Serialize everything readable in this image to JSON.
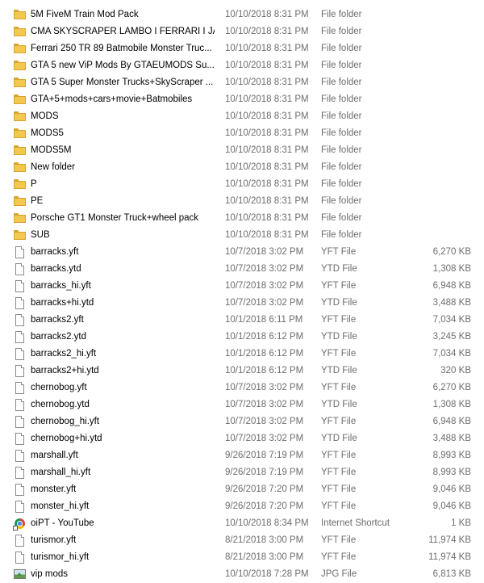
{
  "files": [
    {
      "name": "5M FiveM Train Mod Pack",
      "date": "10/10/2018 8:31 PM",
      "type": "File folder",
      "size": "",
      "icon": "folder-icon"
    },
    {
      "name": "CMA SKYSCRAPER LAMBO I FERRARI I JA...",
      "date": "10/10/2018 8:31 PM",
      "type": "File folder",
      "size": "",
      "icon": "folder-icon"
    },
    {
      "name": "Ferrari 250 TR 89 Batmobile Monster Truc...",
      "date": "10/10/2018 8:31 PM",
      "type": "File folder",
      "size": "",
      "icon": "folder-icon"
    },
    {
      "name": "GTA 5 new ViP Mods By GTAEUMODS Su...",
      "date": "10/10/2018 8:31 PM",
      "type": "File folder",
      "size": "",
      "icon": "folder-icon"
    },
    {
      "name": "GTA 5 Super Monster Trucks+SkyScraper ...",
      "date": "10/10/2018 8:31 PM",
      "type": "File folder",
      "size": "",
      "icon": "folder-icon"
    },
    {
      "name": "GTA+5+mods+cars+movie+Batmobiles",
      "date": "10/10/2018 8:31 PM",
      "type": "File folder",
      "size": "",
      "icon": "folder-icon"
    },
    {
      "name": "MODS",
      "date": "10/10/2018 8:31 PM",
      "type": "File folder",
      "size": "",
      "icon": "folder-icon"
    },
    {
      "name": "MODS5",
      "date": "10/10/2018 8:31 PM",
      "type": "File folder",
      "size": "",
      "icon": "folder-icon"
    },
    {
      "name": "MODS5M",
      "date": "10/10/2018 8:31 PM",
      "type": "File folder",
      "size": "",
      "icon": "folder-icon"
    },
    {
      "name": "New folder",
      "date": "10/10/2018 8:31 PM",
      "type": "File folder",
      "size": "",
      "icon": "folder-icon"
    },
    {
      "name": "P",
      "date": "10/10/2018 8:31 PM",
      "type": "File folder",
      "size": "",
      "icon": "folder-icon"
    },
    {
      "name": "PE",
      "date": "10/10/2018 8:31 PM",
      "type": "File folder",
      "size": "",
      "icon": "folder-icon"
    },
    {
      "name": "Porsche GT1 Monster Truck+wheel pack",
      "date": "10/10/2018 8:31 PM",
      "type": "File folder",
      "size": "",
      "icon": "folder-icon"
    },
    {
      "name": "SUB",
      "date": "10/10/2018 8:31 PM",
      "type": "File folder",
      "size": "",
      "icon": "folder-icon"
    },
    {
      "name": "barracks.yft",
      "date": "10/7/2018 3:02 PM",
      "type": "YFT File",
      "size": "6,270 KB",
      "icon": "file-icon"
    },
    {
      "name": "barracks.ytd",
      "date": "10/7/2018 3:02 PM",
      "type": "YTD File",
      "size": "1,308 KB",
      "icon": "file-icon"
    },
    {
      "name": "barracks_hi.yft",
      "date": "10/7/2018 3:02 PM",
      "type": "YFT File",
      "size": "6,948 KB",
      "icon": "file-icon"
    },
    {
      "name": "barracks+hi.ytd",
      "date": "10/7/2018 3:02 PM",
      "type": "YTD File",
      "size": "3,488 KB",
      "icon": "file-icon"
    },
    {
      "name": "barracks2.yft",
      "date": "10/1/2018 6:11 PM",
      "type": "YFT File",
      "size": "7,034 KB",
      "icon": "file-icon"
    },
    {
      "name": "barracks2.ytd",
      "date": "10/1/2018 6:12 PM",
      "type": "YTD File",
      "size": "3,245 KB",
      "icon": "file-icon"
    },
    {
      "name": "barracks2_hi.yft",
      "date": "10/1/2018 6:12 PM",
      "type": "YFT File",
      "size": "7,034 KB",
      "icon": "file-icon"
    },
    {
      "name": "barracks2+hi.ytd",
      "date": "10/1/2018 6:12 PM",
      "type": "YTD File",
      "size": "320 KB",
      "icon": "file-icon"
    },
    {
      "name": "chernobog.yft",
      "date": "10/7/2018 3:02 PM",
      "type": "YFT File",
      "size": "6,270 KB",
      "icon": "file-icon"
    },
    {
      "name": "chernobog.ytd",
      "date": "10/7/2018 3:02 PM",
      "type": "YTD File",
      "size": "1,308 KB",
      "icon": "file-icon"
    },
    {
      "name": "chernobog_hi.yft",
      "date": "10/7/2018 3:02 PM",
      "type": "YFT File",
      "size": "6,948 KB",
      "icon": "file-icon"
    },
    {
      "name": "chernobog+hi.ytd",
      "date": "10/7/2018 3:02 PM",
      "type": "YTD File",
      "size": "3,488 KB",
      "icon": "file-icon"
    },
    {
      "name": "marshall.yft",
      "date": "9/26/2018 7:19 PM",
      "type": "YFT File",
      "size": "8,993 KB",
      "icon": "file-icon"
    },
    {
      "name": "marshall_hi.yft",
      "date": "9/26/2018 7:19 PM",
      "type": "YFT File",
      "size": "8,993 KB",
      "icon": "file-icon"
    },
    {
      "name": "monster.yft",
      "date": "9/26/2018 7:20 PM",
      "type": "YFT File",
      "size": "9,046 KB",
      "icon": "file-icon"
    },
    {
      "name": "monster_hi.yft",
      "date": "9/26/2018 7:20 PM",
      "type": "YFT File",
      "size": "9,046 KB",
      "icon": "file-icon"
    },
    {
      "name": "oiPT - YouTube",
      "date": "10/10/2018 8:34 PM",
      "type": "Internet Shortcut",
      "size": "1 KB",
      "icon": "chrome-shortcut-icon"
    },
    {
      "name": "turismor.yft",
      "date": "8/21/2018 3:00 PM",
      "type": "YFT File",
      "size": "11,974 KB",
      "icon": "file-icon"
    },
    {
      "name": "turismor_hi.yft",
      "date": "8/21/2018 3:00 PM",
      "type": "YFT File",
      "size": "11,974 KB",
      "icon": "file-icon"
    },
    {
      "name": "vip mods",
      "date": "10/10/2018 7:28 PM",
      "type": "JPG File",
      "size": "6,813 KB",
      "icon": "image-icon"
    }
  ]
}
